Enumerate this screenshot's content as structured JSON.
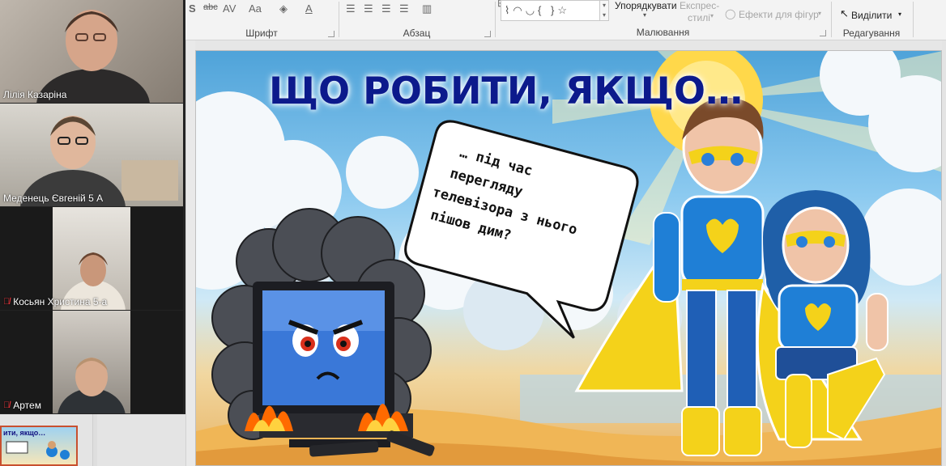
{
  "ribbon": {
    "groups": {
      "font": "Шрифт",
      "paragraph": "Абзац",
      "drawing": "Малювання",
      "editing": "Редагування"
    },
    "buttons": {
      "arrange": "Упорядкувати",
      "quick_styles_line1": "Експрес-",
      "quick_styles_line2": "стилі",
      "shape_effects": "Ефекти для фігур",
      "select": "Виділити"
    },
    "font_tools": {
      "strikethrough": "abc",
      "spacing": "AV",
      "case": "Aa",
      "font_color": "A"
    }
  },
  "participants": [
    {
      "name": "Лілія Казаріна",
      "muted": false,
      "active": false
    },
    {
      "name": "Меденець Євгеній 5 А",
      "muted": false,
      "active": true
    },
    {
      "name": "Косьян Христина 5-а",
      "muted": true,
      "active": false
    },
    {
      "name": "Артем",
      "muted": true,
      "active": false
    }
  ],
  "slide": {
    "title": "ЩО РОБИТИ, ЯКЩО…",
    "bubble_lines": [
      "… під час",
      "перегляду",
      "телевізора з нього",
      "пішов дим?"
    ]
  },
  "thumbnail": {
    "title": "ити, якщо…"
  },
  "colors": {
    "title": "#0c1a8c",
    "active_tile": "#8cc63e",
    "muted_icon": "#e8343a",
    "hero_blue": "#1f7fd6",
    "hero_yellow": "#f4d21a"
  }
}
